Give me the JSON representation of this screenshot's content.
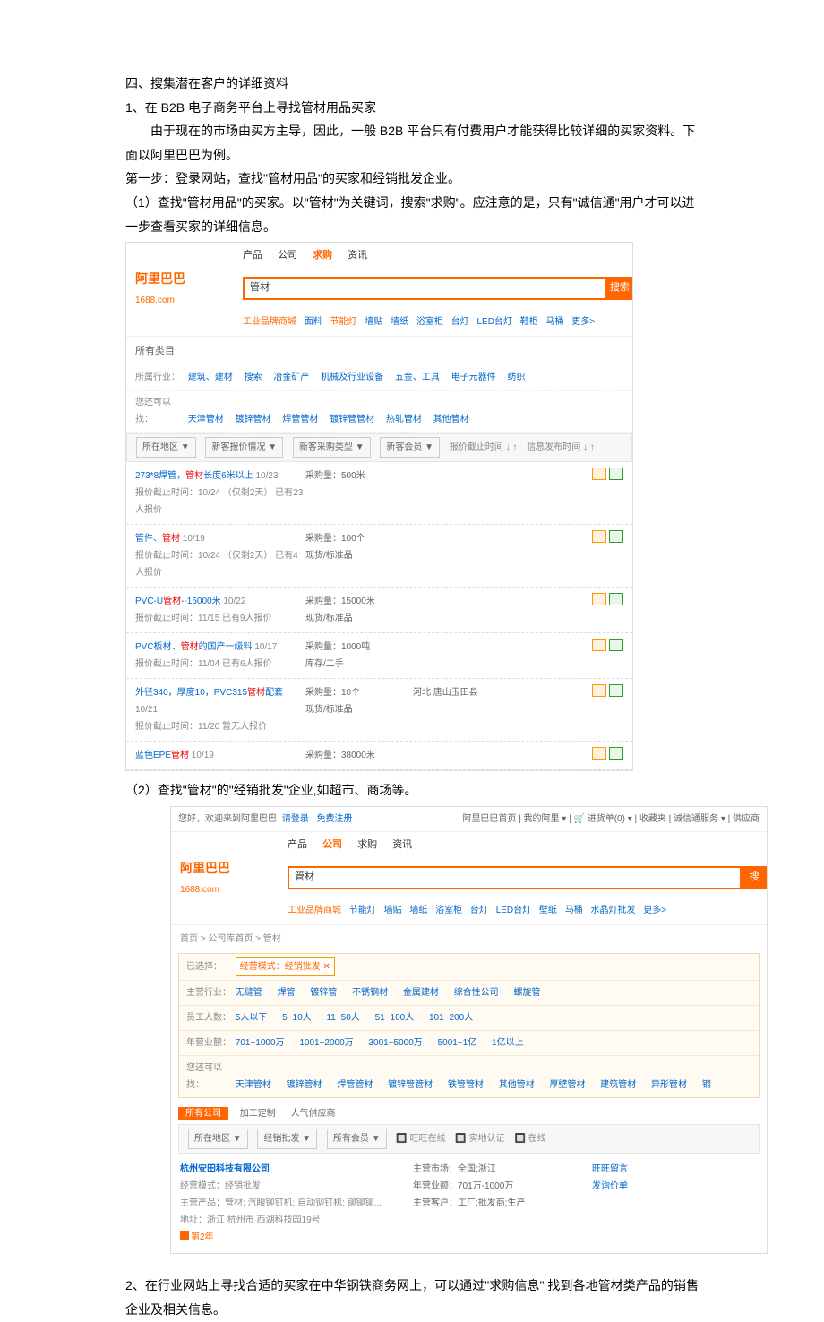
{
  "doc": {
    "h1": "四、搜集潜在客户的详细资料",
    "p1": "1、在 B2B 电子商务平台上寻找管材用品买家",
    "p2": "由于现在的市场由买方主导，因此，一般 B2B 平台只有付费用户才能获得比较详细的买家资料。下面以阿里巴巴为例。",
    "p3": "第一步：登录网站，查找\"管材用品\"的买家和经销批发企业。",
    "p4": "（1）查找\"管材用品\"的买家。以\"管材\"为关键词，搜索\"求购\"。应注意的是，只有\"诚信通\"用户才可以进一步查看买家的详细信息。",
    "p5": "（2）查找\"管材\"的\"经销批发\"企业,如超市、商场等。",
    "p6": "2、在行业网站上寻找合适的买家在中华钢铁商务网上，可以通过\"求购信息\" 找到各地管材类产品的销售企业及相关信息。"
  },
  "sc1": {
    "tabs": [
      "产品",
      "公司",
      "求购",
      "资讯"
    ],
    "logo": "阿里巴巴",
    "logo_sub": "1688.com",
    "search_value": "管材",
    "search_btn": "搜索",
    "hot_prefix": "工业品牌商城",
    "hot": [
      "面料",
      "节能灯",
      "墙贴",
      "墙纸",
      "浴室柜",
      "台灯",
      "LED台灯",
      "鞋柜",
      "马桶",
      "更多>"
    ],
    "all_cat": "所有类目",
    "row1_lbl": "所属行业：",
    "row1": [
      "建筑、建材",
      "搜索",
      "冶金矿产",
      "机械及行业设备",
      "五金、工具",
      "电子元器件",
      "纺织"
    ],
    "row2_lbl": "您还可以找：",
    "row2": [
      "天津管材",
      "镀锌管材",
      "焊管管材",
      "镀锌管管材",
      "热轧管材",
      "其他管材"
    ],
    "row3": [
      "所在地区 ▼",
      "新客报价情况 ▼",
      "新客采购类型 ▼",
      "新客会员 ▼",
      "报价截止时间 ↓ ↑",
      "信息发布时间 ↓ ↑"
    ],
    "items": [
      {
        "title": "273*8焊管，",
        "hl": "管材",
        "t2": "长度6米以上",
        "date": "10/23",
        "sub": "报价截止时间：10/24 （仅剩2天） 已有23人报价",
        "qty": "采购量：500米"
      },
      {
        "title": "管件、",
        "hl": "管材",
        "date": "10/19",
        "sub": "报价截止时间：10/24 （仅剩2天） 已有4人报价",
        "qty": "采购量：100个",
        "extra": "现货/标准品"
      },
      {
        "title": "PVC-U",
        "hl": "管材",
        "t2": "--15000米",
        "date": "10/22",
        "sub": "报价截止时间：11/15  已有9人报价",
        "qty": "采购量：15000米",
        "extra": "现货/标准品"
      },
      {
        "title": "PVC板材、",
        "hl": "管材",
        "t2": "的国产一级料",
        "date": "10/17",
        "sub": "报价截止时间：11/04  已有6人报价",
        "qty": "采购量：1000吨",
        "extra": "库存/二手"
      },
      {
        "title": "外径340，厚度10，PVC315",
        "hl": "管材",
        "t2": "配套",
        "date": "10/21",
        "sub": "报价截止时间：11/20  暂无人报价",
        "qty": "采购量：10个",
        "extra": "现货/标准品",
        "loc": "河北\n唐山玉田县"
      },
      {
        "title": "蓝色EPE",
        "hl": "管材",
        "date": "10/19",
        "sub": "",
        "qty": "采购量：38000米"
      }
    ]
  },
  "sc2": {
    "topbar_pre": "您好，欢迎来到阿里巴巴",
    "topbar_login": "请登录",
    "topbar_reg": "免费注册",
    "topbar_mid": "阿里巴巴首页 | 我的阿里 ▾ | 🛒 进货单(0) ▾ | 收藏夹 | 诚信通服务 ▾ | 供应商",
    "tabs": [
      "产品",
      "公司",
      "求购",
      "资讯"
    ],
    "logo": "阿里巴巴",
    "logo_sub": "1688.com",
    "search_value": "管材",
    "search_btn": "搜",
    "hot_prefix": "工业品牌商城",
    "hot": [
      "节能灯",
      "墙贴",
      "墙纸",
      "浴室柜",
      "台灯",
      "LED台灯",
      "壁纸",
      "马桶",
      "水晶灯批发",
      "更多>"
    ],
    "breadcrumb": "首页 > 公司库首页 > 管材",
    "selected_lbl": "已选择：",
    "selected_tag": "经营模式：经销批发 ✕",
    "f1_lbl": "主营行业：",
    "f1": [
      "无缝管",
      "焊管",
      "镀锌管",
      "不锈钢材",
      "金属建材",
      "综合性公司",
      "螺旋管"
    ],
    "f2_lbl": "员工人数：",
    "f2": [
      "5人以下",
      "5~10人",
      "11~50人",
      "51~100人",
      "101~200人"
    ],
    "f3_lbl": "年营业额：",
    "f3": [
      "701~1000万",
      "1001~2000万",
      "3001~5000万",
      "5001~1亿",
      "1亿以上"
    ],
    "f4_lbl": "您还可以找：",
    "f4": [
      "天津管材",
      "镀锌管材",
      "焊管管材",
      "镀锌管管材",
      "铁管管材",
      "其他管材",
      "厚壁管材",
      "建筑管材",
      "异形管材",
      "钢"
    ],
    "tabs2": [
      "所有公司",
      "加工定制",
      "人气供应商"
    ],
    "bar": [
      "所在地区 ▼",
      "经销批发 ▼",
      "所有会员 ▼",
      "🔲 旺旺在线",
      "🔲 实地认证",
      "🔲 在线"
    ],
    "co_name": "杭州安田科技有限公司",
    "co_sub": "经营模式：经销批发",
    "co_prod": "主营产品：管材; 汽眼铆钉机; 自动铆钉机; 铆铆铆...",
    "co_addr": "地址：浙江 杭州市 西湖科技园19号",
    "co_badge": "第2年",
    "co_m1": "主营市场：全国;浙江",
    "co_m2": "年营业额：701万-1000万",
    "co_m3": "主营客户：工厂;批发商;生产",
    "btn1": "旺旺留言",
    "btn2": "发询价单"
  }
}
